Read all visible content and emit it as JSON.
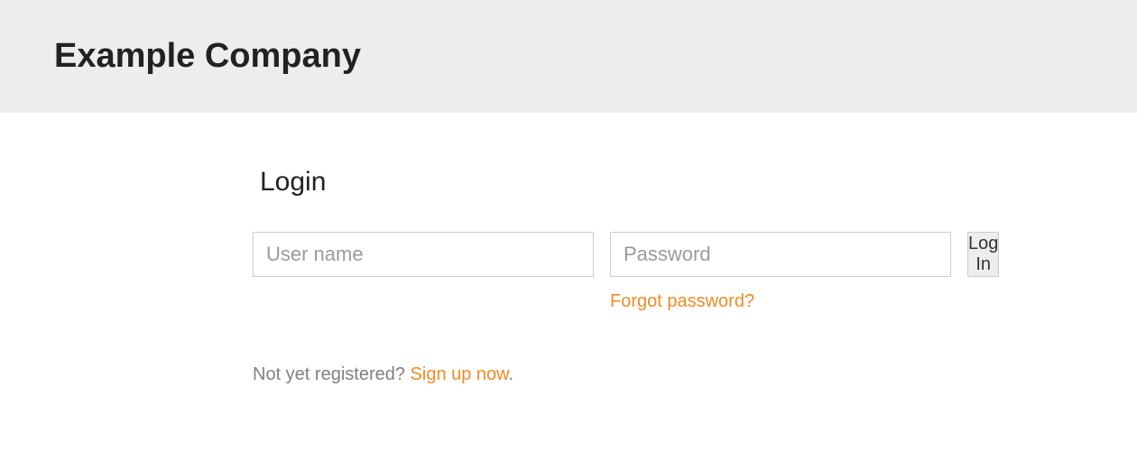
{
  "header": {
    "company_name": "Example Company"
  },
  "login": {
    "title": "Login",
    "username_placeholder": "User name",
    "username_value": "",
    "password_placeholder": "Password",
    "password_value": "",
    "login_button_label": "Log In",
    "forgot_password_label": "Forgot password?",
    "not_registered_text": "Not yet registered? ",
    "signup_link_label": "Sign up now",
    "signup_period": "."
  },
  "colors": {
    "accent": "#f08a24",
    "header_bg": "#ededed",
    "text_dark": "#222222",
    "text_muted": "#808080",
    "border": "#cccccc"
  }
}
